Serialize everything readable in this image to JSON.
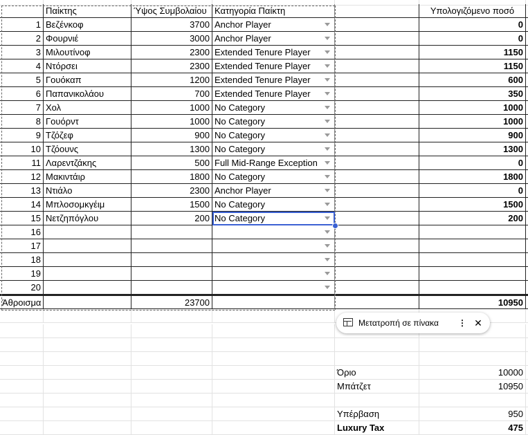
{
  "headers": {
    "col_player": "Παίκτης",
    "col_contract": "Ύψος Συμβολαίου",
    "col_category": "Κατηγορία Παίκτη",
    "col_amount": "Υπολογιζόμενο ποσό"
  },
  "rows": [
    {
      "n": "1",
      "player": "Βεζένκοφ",
      "contract": "3700",
      "category": "Anchor Player",
      "amount": "0"
    },
    {
      "n": "2",
      "player": "Φουρνιέ",
      "contract": "3000",
      "category": "Anchor Player",
      "amount": "0"
    },
    {
      "n": "3",
      "player": "Μιλουτίνοφ",
      "contract": "2300",
      "category": "Extended Tenure Player",
      "amount": "1150"
    },
    {
      "n": "4",
      "player": "Ντόρσει",
      "contract": "2300",
      "category": "Extended Tenure Player",
      "amount": "1150"
    },
    {
      "n": "5",
      "player": "Γουόκαπ",
      "contract": "1200",
      "category": "Extended Tenure Player",
      "amount": "600"
    },
    {
      "n": "6",
      "player": "Παπανικολάου",
      "contract": "700",
      "category": "Extended Tenure Player",
      "amount": "350"
    },
    {
      "n": "7",
      "player": "Χολ",
      "contract": "1000",
      "category": "No Category",
      "amount": "1000"
    },
    {
      "n": "8",
      "player": "Γουόρντ",
      "contract": "1000",
      "category": "No Category",
      "amount": "1000"
    },
    {
      "n": "9",
      "player": "Τζόζεφ",
      "contract": "900",
      "category": "No Category",
      "amount": "900"
    },
    {
      "n": "10",
      "player": "Τζόουνς",
      "contract": "1300",
      "category": "No Category",
      "amount": "1300"
    },
    {
      "n": "11",
      "player": "Λαρεντζάκης",
      "contract": "500",
      "category": "Full Mid-Range Exception",
      "amount": "0"
    },
    {
      "n": "12",
      "player": "Μακιντάιρ",
      "contract": "1800",
      "category": "No Category",
      "amount": "1800"
    },
    {
      "n": "13",
      "player": "Ντιάλο",
      "contract": "2300",
      "category": "Anchor Player",
      "amount": "0"
    },
    {
      "n": "14",
      "player": "Μπλοσομκγέιμ",
      "contract": "1500",
      "category": "No Category",
      "amount": "1500"
    },
    {
      "n": "15",
      "player": "Νετζηπόγλου",
      "contract": "200",
      "category": "No Category",
      "amount": "200"
    },
    {
      "n": "16",
      "player": "",
      "contract": "",
      "category": "",
      "amount": ""
    },
    {
      "n": "17",
      "player": "",
      "contract": "",
      "category": "",
      "amount": ""
    },
    {
      "n": "18",
      "player": "",
      "contract": "",
      "category": "",
      "amount": ""
    },
    {
      "n": "19",
      "player": "",
      "contract": "",
      "category": "",
      "amount": ""
    },
    {
      "n": "20",
      "player": "",
      "contract": "",
      "category": "",
      "amount": ""
    }
  ],
  "totals": {
    "label": "Άθροισμα",
    "contract": "23700",
    "amount": "10950"
  },
  "summary": {
    "limit_label": "Όριο",
    "limit_value": "10000",
    "budget_label": "Μπάτζετ",
    "budget_value": "10950",
    "overage_label": "Υπέρβαση",
    "overage_value": "950",
    "tax_label": "Luxury Tax",
    "tax_value": "475"
  },
  "toast": {
    "label": "Μετατροπή σε πίνακα",
    "more": "⋮",
    "close": "✕"
  },
  "selected_row": 15
}
